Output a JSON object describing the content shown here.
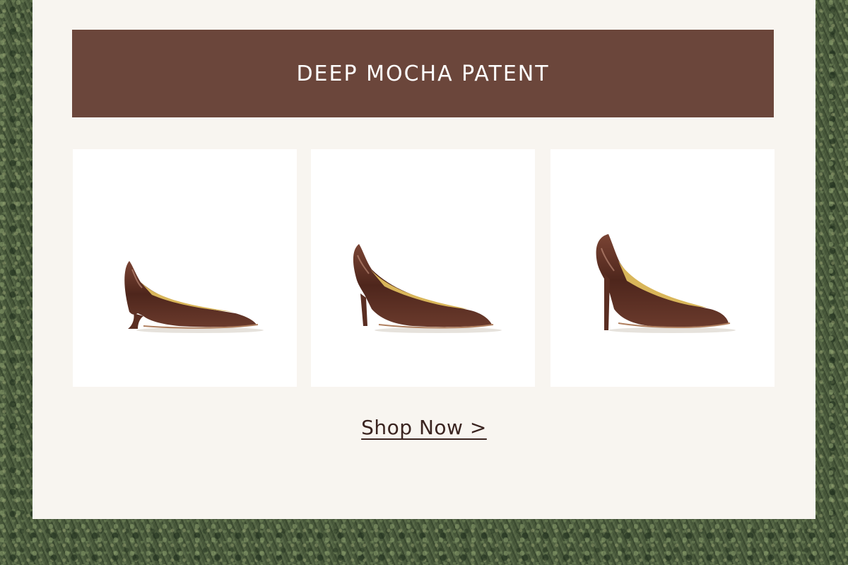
{
  "banner": {
    "title": "DEEP MOCHA PATENT"
  },
  "products": [
    {
      "icon": "kitten-heel-pump-icon"
    },
    {
      "icon": "mid-heel-pump-icon"
    },
    {
      "icon": "high-heel-pump-icon"
    }
  ],
  "cta": {
    "label": "Shop Now >"
  },
  "colors": {
    "banner_bg": "#6b463b",
    "card_bg": "#f8f5f0",
    "shoe_patent": "#5a2e22",
    "shoe_lining": "#d9b65a",
    "cta_text": "#3a2420"
  }
}
